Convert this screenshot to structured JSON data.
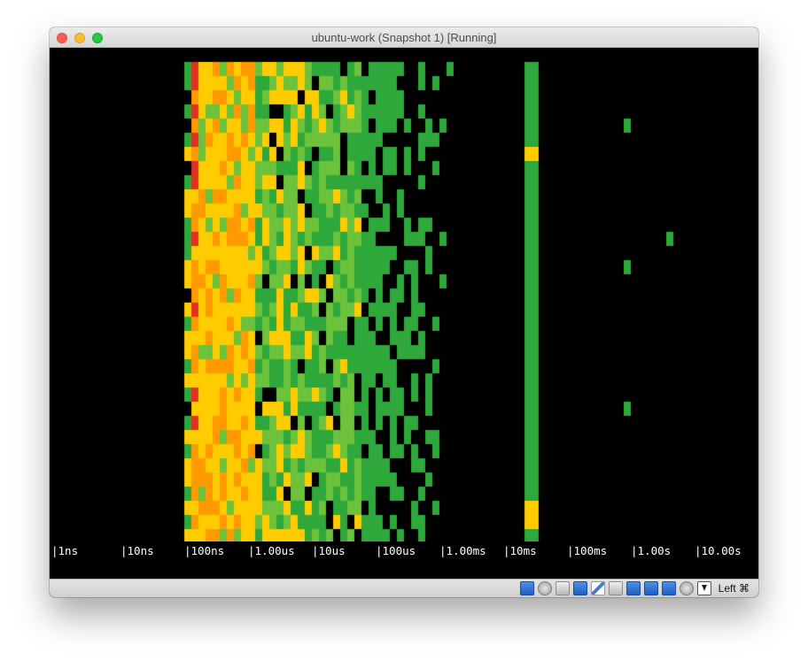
{
  "window": {
    "title": "ubuntu-work (Snapshot 1) [Running]"
  },
  "screen": {
    "axis_ticks": [
      {
        "label": "|1ns"
      },
      {
        "label": "|10ns"
      },
      {
        "label": "|100ns"
      },
      {
        "label": "|1.00us"
      },
      {
        "label": "|10us"
      },
      {
        "label": "|100us"
      },
      {
        "label": "|1.00ms"
      },
      {
        "label": "|10ms"
      },
      {
        "label": "|100ms"
      },
      {
        "label": "|1.00s"
      },
      {
        "label": "|10.00s"
      }
    ],
    "colors": {
      "background": "#000000",
      "red": "#e03020",
      "orange": "#ff9a00",
      "yellow": "#ffcc00",
      "light_green": "#6cc23a",
      "green": "#2ea83a",
      "axis_text": "#ffffff"
    }
  },
  "statusbar": {
    "icons": [
      "network-adapter-icon",
      "optical-drive-icon",
      "usb-icon",
      "hard-disk-icon",
      "shared-folder-icon",
      "display-icon",
      "screen-icon",
      "video-capture-icon",
      "mouse-integration-icon",
      "cpu-icon",
      "download-icon"
    ],
    "host_key": "Left ⌘"
  }
}
